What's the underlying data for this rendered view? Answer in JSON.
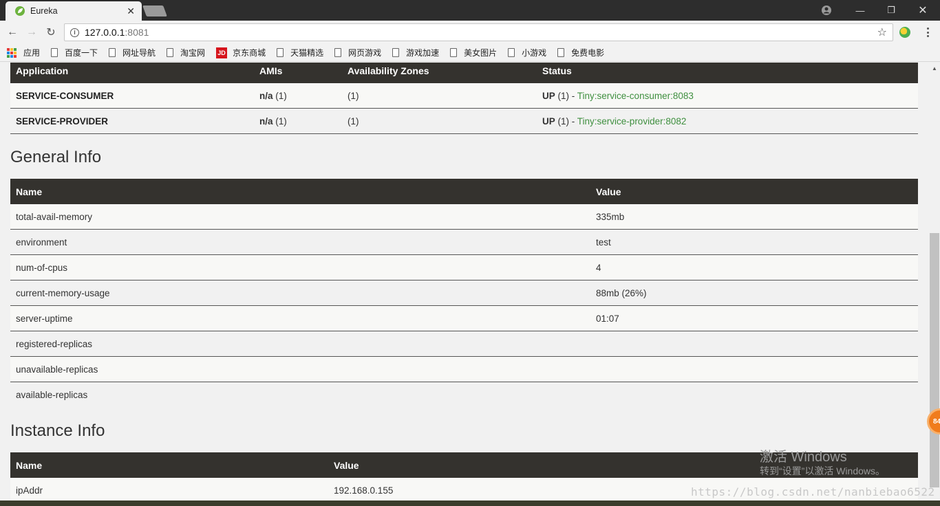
{
  "browser": {
    "tab_title": "Eureka",
    "url_host": "127.0.0.1",
    "url_port": ":8081",
    "bookmarks": [
      "应用",
      "百度一下",
      "网址导航",
      "淘宝网",
      "京东商城",
      "天猫精选",
      "网页游戏",
      "游戏加速",
      "美女图片",
      "小游戏",
      "免费电影"
    ],
    "jd_logo_text": "JD"
  },
  "applications": {
    "headers": [
      "Application",
      "AMIs",
      "Availability Zones",
      "Status"
    ],
    "rows": [
      {
        "name": "SERVICE-CONSUMER",
        "amis_bold": "n/a",
        "amis_count": "(1)",
        "zones": "(1)",
        "status": "UP",
        "status_count": "(1) -",
        "instance": "Tiny:service-consumer:8083"
      },
      {
        "name": "SERVICE-PROVIDER",
        "amis_bold": "n/a",
        "amis_count": "(1)",
        "zones": "(1)",
        "status": "UP",
        "status_count": "(1) -",
        "instance": "Tiny:service-provider:8082"
      }
    ]
  },
  "general_info": {
    "title": "General Info",
    "headers": [
      "Name",
      "Value"
    ],
    "rows": [
      {
        "name": "total-avail-memory",
        "value": "335mb"
      },
      {
        "name": "environment",
        "value": "test"
      },
      {
        "name": "num-of-cpus",
        "value": "4"
      },
      {
        "name": "current-memory-usage",
        "value": "88mb (26%)"
      },
      {
        "name": "server-uptime",
        "value": "01:07"
      },
      {
        "name": "registered-replicas",
        "value": ""
      },
      {
        "name": "unavailable-replicas",
        "value": ""
      },
      {
        "name": "available-replicas",
        "value": ""
      }
    ]
  },
  "instance_info": {
    "title": "Instance Info",
    "headers": [
      "Name",
      "Value"
    ],
    "rows": [
      {
        "name": "ipAddr",
        "value": "192.168.0.155"
      }
    ]
  },
  "overlay": {
    "badge_text": "84",
    "watermark_title": "激活 Windows",
    "watermark_sub": "转到“设置”以激活 Windows。",
    "watermark_url": "https://blog.csdn.net/nanbiebao6522"
  },
  "colors": {
    "header_bg": "#34322e",
    "link_green": "#3f8f3f",
    "page_bg": "#f1f1f1"
  }
}
